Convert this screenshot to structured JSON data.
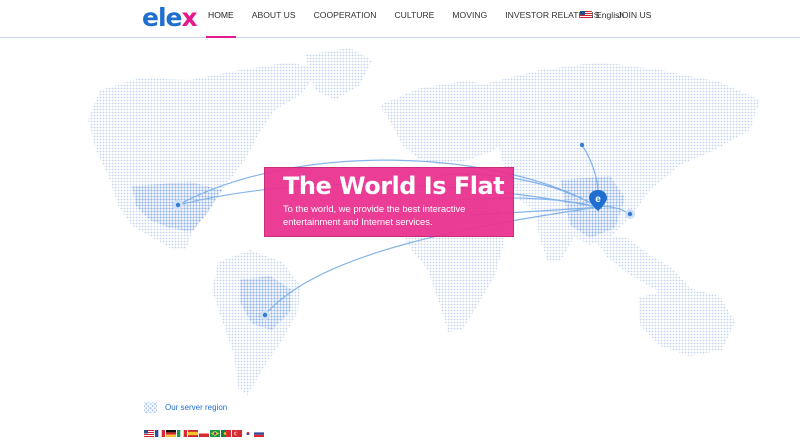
{
  "brand": {
    "part1": "ele",
    "part2": "x"
  },
  "nav": {
    "items": [
      {
        "label": "HOME",
        "active": true
      },
      {
        "label": "ABOUT US",
        "active": false
      },
      {
        "label": "COOPERATION",
        "active": false
      },
      {
        "label": "CULTURE",
        "active": false
      },
      {
        "label": "MOVING",
        "active": false
      },
      {
        "label": "INVESTOR RELATIONS",
        "active": false
      },
      {
        "label": "JOIN US",
        "active": false
      }
    ],
    "language": {
      "label": "English",
      "flag": "us-flag-icon"
    }
  },
  "hero": {
    "title": "The World Is Flat",
    "subtitle": "To the world, we provide the best interactive entertainment and Internet services."
  },
  "legend": {
    "label": "Our server region"
  },
  "server_flags": [
    "us-flag-icon",
    "fr-flag-icon",
    "de-flag-icon",
    "it-flag-icon",
    "es-flag-icon",
    "pl-flag-icon",
    "br-flag-icon",
    "pt-flag-icon",
    "tr-flag-icon",
    "kr-flag-icon",
    "ru-flag-icon"
  ],
  "colors": {
    "accent_pink": "#e5198a",
    "brand_blue": "#1f6fd0",
    "map_dots": "#c9d7f1",
    "route": "#7fb0ea"
  }
}
